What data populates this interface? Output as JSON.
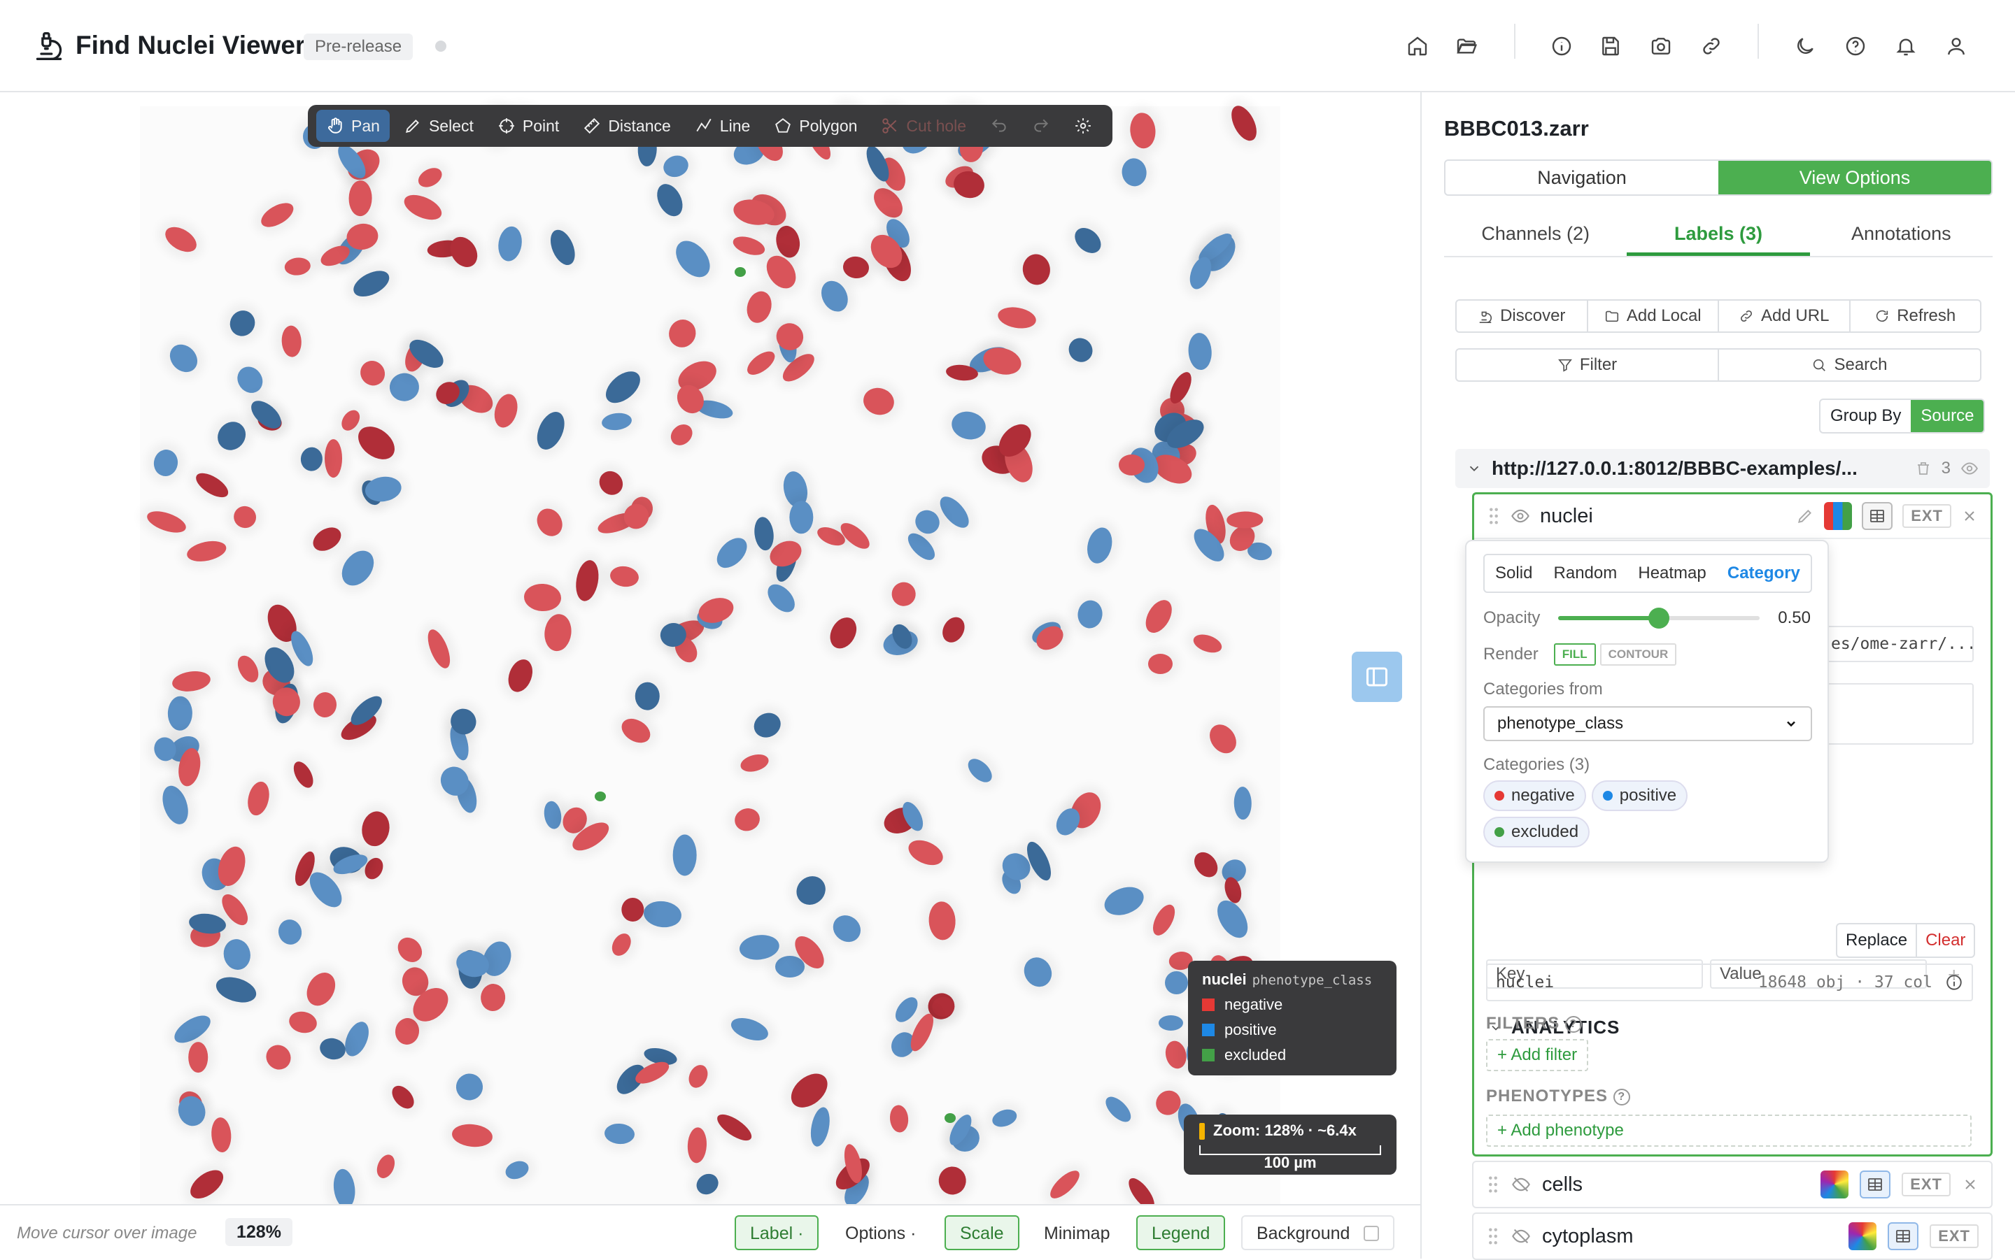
{
  "app": {
    "title": "Find Nuclei Viewer",
    "badge": "Pre-release"
  },
  "header_icons": [
    "home-icon",
    "folder-open-icon",
    "info-icon",
    "save-icon",
    "camera-icon",
    "link-icon",
    "moon-icon",
    "help-icon",
    "bell-icon",
    "user-icon"
  ],
  "toolbar": {
    "tools": [
      {
        "label": "Pan",
        "icon": "hand-icon",
        "state": "active"
      },
      {
        "label": "Select",
        "icon": "pen-icon",
        "state": "normal"
      },
      {
        "label": "Point",
        "icon": "crosshair-icon",
        "state": "normal"
      },
      {
        "label": "Distance",
        "icon": "ruler-icon",
        "state": "normal"
      },
      {
        "label": "Line",
        "icon": "polyline-icon",
        "state": "normal"
      },
      {
        "label": "Polygon",
        "icon": "pentagon-icon",
        "state": "normal"
      },
      {
        "label": "Cut hole",
        "icon": "scissors-icon",
        "state": "disabled"
      }
    ]
  },
  "legend": {
    "layer": "nuclei",
    "field": "phenotype_class",
    "items": [
      {
        "label": "negative",
        "color": "#e53935"
      },
      {
        "label": "positive",
        "color": "#1e88e5"
      },
      {
        "label": "excluded",
        "color": "#43a047"
      }
    ]
  },
  "zoom_overlay": {
    "text": "Zoom: 128% · ~6.4x",
    "scale": "100 µm"
  },
  "bottom_bar": {
    "cursor_hint": "Move cursor over image",
    "zoom": "128%",
    "label_btn": "Label ·",
    "options_btn": "Options ·",
    "scale_btn": "Scale",
    "minimap_btn": "Minimap",
    "legend_btn": "Legend",
    "background_btn": "Background"
  },
  "panel": {
    "title": "BBBC013.zarr",
    "seg": [
      "Navigation",
      "View Options"
    ],
    "tabs": [
      "Channels (2)",
      "Labels (3)",
      "Annotations"
    ],
    "actions": [
      "Discover",
      "Add Local",
      "Add URL",
      "Refresh"
    ],
    "filter": "Filter",
    "search": "Search",
    "group_by": "Group By",
    "group_by_value": "Source",
    "source_url": "http://127.0.0.1:8012/BBBC-examples/...",
    "source_count": "3",
    "layer": {
      "name": "nuclei",
      "ext": "EXT"
    },
    "partial_path": "es/ome-zarr/...",
    "popup": {
      "modes": [
        "Solid",
        "Random",
        "Heatmap",
        "Category"
      ],
      "active_mode": "Category",
      "opacity_label": "Opacity",
      "opacity_value": "0.50",
      "opacity": 0.5,
      "render_label": "Render",
      "fill": "FILL",
      "contour": "CONTOUR",
      "categories_from_label": "Categories from",
      "categories_from": "phenotype_class",
      "categories_label": "Categories (3)",
      "categories": [
        {
          "label": "negative",
          "color": "#e53935"
        },
        {
          "label": "positive",
          "color": "#1e88e5"
        },
        {
          "label": "excluded",
          "color": "#43a047"
        }
      ]
    },
    "kv": {
      "key": "Key",
      "value": "Value"
    },
    "analytics": {
      "title": "ANALYTICS",
      "replace": "Replace",
      "clear": "Clear",
      "table": "nuclei",
      "stats": "18648 obj · 37 col",
      "filters_label": "FILTERS",
      "add_filter": "+ Add filter",
      "phenotypes_label": "PHENOTYPES",
      "add_phenotype": "+ Add phenotype"
    },
    "other_layers": [
      {
        "name": "cells",
        "ext": "EXT"
      },
      {
        "name": "cytoplasm",
        "ext": "EXT"
      }
    ]
  }
}
